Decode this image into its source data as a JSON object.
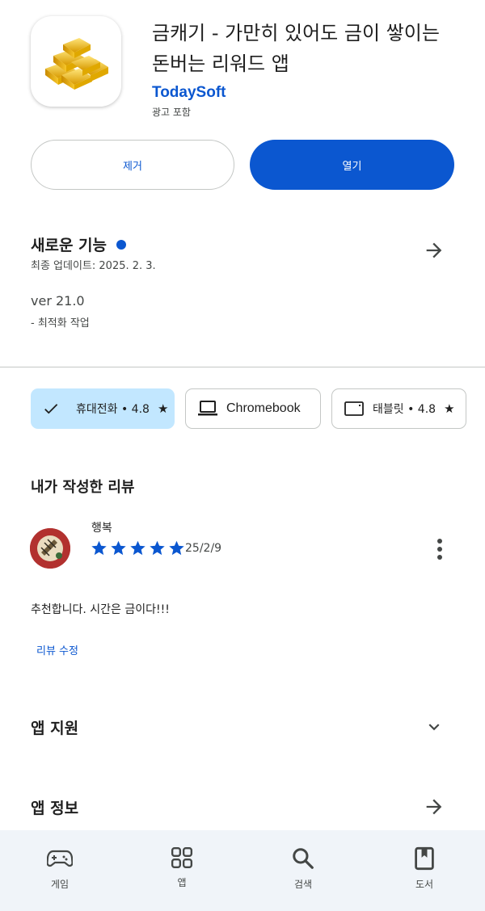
{
  "app": {
    "title": "금캐기 - 가만히 있어도 금이 쌓이는 돈버는 리워드 앱",
    "developer": "TodaySoft",
    "ads_label": "광고 포함",
    "icon": "gold-bars-icon"
  },
  "actions": {
    "remove_label": "제거",
    "open_label": "열기"
  },
  "whats_new": {
    "title": "새로운 기능",
    "updated": "최종 업데이트: 2025. 2. 3.",
    "version": "ver 21.0",
    "note": "- 최적화 작업"
  },
  "device_chips": [
    {
      "label": "휴대전화 • 4.8",
      "icon": "check-icon",
      "selected": true
    },
    {
      "label": "Chromebook",
      "icon": "laptop-icon",
      "selected": false
    },
    {
      "label": "태블릿 • 4.8",
      "icon": "tablet-icon",
      "selected": false
    }
  ],
  "my_review": {
    "section_title": "내가 작성한 리뷰",
    "reviewer": "행복",
    "rating": 5,
    "date": "25/2/9",
    "text": "추천합니다. 시간은 금이다!!!",
    "edit_label": "리뷰 수정"
  },
  "app_support": {
    "title": "앱 지원"
  },
  "app_info": {
    "title": "앱 정보"
  },
  "bottom_nav": [
    {
      "label": "게임",
      "icon": "gamepad-icon"
    },
    {
      "label": "앱",
      "icon": "apps-grid-icon"
    },
    {
      "label": "검색",
      "icon": "search-icon"
    },
    {
      "label": "도서",
      "icon": "book-icon"
    }
  ],
  "colors": {
    "accent": "#0b57d0",
    "chip_selected": "#c2e7ff",
    "nav_background": "#f0f4f9"
  }
}
